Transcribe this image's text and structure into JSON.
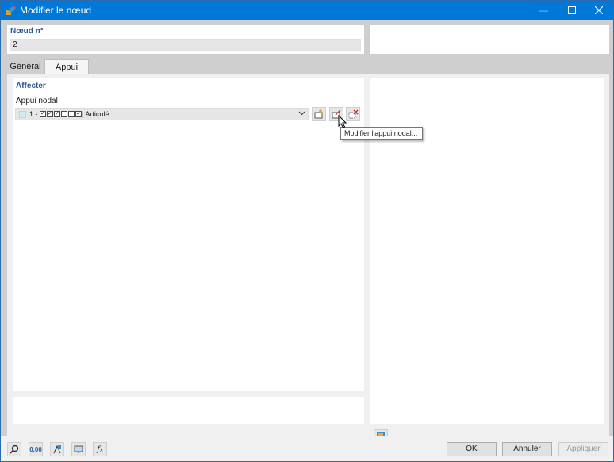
{
  "window": {
    "title": "Modifier le nœud"
  },
  "node": {
    "label": "Nœud n°",
    "value": "2"
  },
  "tabs": [
    {
      "label": "Général"
    },
    {
      "label": "Appui"
    }
  ],
  "assign": {
    "section_title": "Affecter",
    "field_label": "Appui nodal",
    "combo": {
      "number": "1 -",
      "name": "| Articulé",
      "swatch_color": "#cfeef6"
    }
  },
  "tooltip": {
    "text": "Modifier l'appui nodal..."
  },
  "footer": {
    "ok_label": "OK",
    "cancel_label": "Annuler",
    "apply_label": "Appliquer",
    "value_icon_text": "0,00"
  },
  "colors": {
    "titlebar": "#0078d7",
    "section_title": "#2b5592",
    "content_bg": "#cfcfcf"
  },
  "icons": [
    "app-icon",
    "minimize-icon",
    "maximize-icon",
    "close-icon",
    "new-support-icon",
    "edit-support-icon",
    "delete-support-icon",
    "chevron-down-icon",
    "search-icon",
    "value-display-icon",
    "units-icon",
    "view-icon",
    "function-icon",
    "info-table-icon"
  ]
}
